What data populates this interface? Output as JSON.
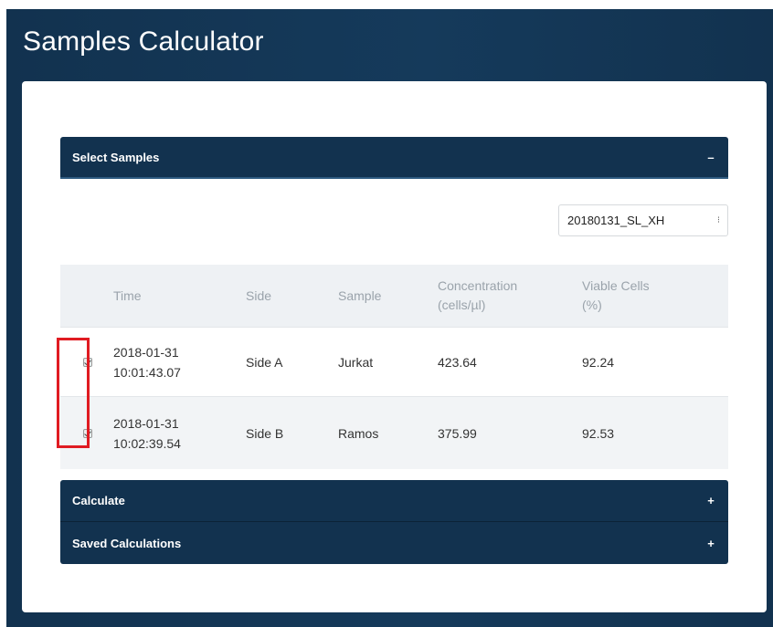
{
  "app": {
    "title": "Samples Calculator"
  },
  "panels": {
    "select_samples": {
      "label": "Select Samples",
      "toggle": "–"
    },
    "calculate": {
      "label": "Calculate",
      "toggle": "+"
    },
    "saved_calculations": {
      "label": "Saved Calculations",
      "toggle": "+"
    }
  },
  "file_select": {
    "value": "20180131_SL_XH",
    "arrows": "⁝"
  },
  "table": {
    "headers": {
      "time": "Time",
      "side": "Side",
      "sample": "Sample",
      "concentration_line1": "Concentration",
      "concentration_line2": "(cells/µl)",
      "viable_line1": "Viable Cells",
      "viable_line2": "(%)"
    },
    "rows": [
      {
        "checked": true,
        "date": "2018-01-31",
        "time": "10:01:43.07",
        "side": "Side A",
        "sample": "Jurkat",
        "concentration": "423.64",
        "viable": "92.24"
      },
      {
        "checked": true,
        "date": "2018-01-31",
        "time": "10:02:39.54",
        "side": "Side B",
        "sample": "Ramos",
        "concentration": "375.99",
        "viable": "92.53"
      }
    ]
  },
  "colors": {
    "header_navy": "#12324f",
    "highlight_red": "#e01b22",
    "table_header_bg": "#eef1f4"
  }
}
